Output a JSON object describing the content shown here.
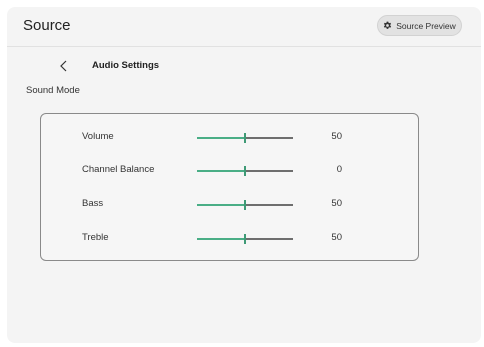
{
  "header": {
    "title": "Source",
    "preview_label": "Source Preview"
  },
  "nav": {
    "subtitle": "Audio Settings"
  },
  "section": {
    "label": "Sound Mode"
  },
  "settings": [
    {
      "label": "Volume",
      "value": "50",
      "level": 0.5
    },
    {
      "label": "Channel Balance",
      "value": "0",
      "level": 0.5
    },
    {
      "label": "Bass",
      "value": "50",
      "level": 0.5
    },
    {
      "label": "Treble",
      "value": "50",
      "level": 0.5
    }
  ],
  "colors": {
    "accent": "#4aae86",
    "track": "#6e6e6e"
  },
  "icons": {
    "preview": "gear-icon",
    "back": "chevron-left-icon"
  }
}
